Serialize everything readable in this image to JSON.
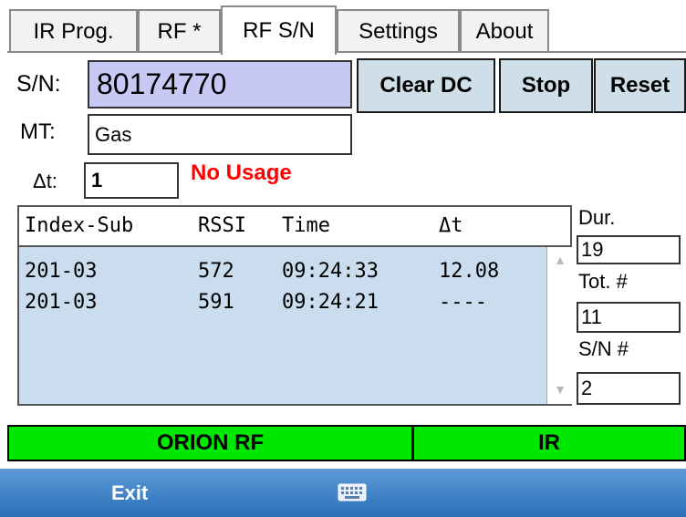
{
  "tabs": [
    {
      "label": "IR Prog.",
      "active": false
    },
    {
      "label": "RF *",
      "active": false
    },
    {
      "label": "RF S/N",
      "active": true
    },
    {
      "label": "Settings",
      "active": false
    },
    {
      "label": "About",
      "active": false
    }
  ],
  "sn": {
    "label": "S/N:",
    "value": "80174770"
  },
  "buttons": {
    "clear_dc": "Clear DC",
    "stop": "Stop",
    "reset": "Reset"
  },
  "mt": {
    "label": "MT:",
    "value": "Gas"
  },
  "dt": {
    "label": "Δt:",
    "value": "1",
    "status": "No Usage",
    "status_color": "#ff0000"
  },
  "list": {
    "headers": [
      "Index-Sub",
      "RSSI",
      "Time",
      "Δt"
    ],
    "rows": [
      {
        "index_sub": "201-03",
        "rssi": "572",
        "time": "09:24:33",
        "dt": "12.08"
      },
      {
        "index_sub": "201-03",
        "rssi": "591",
        "time": "09:24:21",
        "dt": "----"
      }
    ]
  },
  "side": {
    "dur_label": "Dur.",
    "dur_value": "19",
    "tot_label": "Tot. #",
    "tot_value": "11",
    "sn_label": "S/N #",
    "sn_value": "2"
  },
  "status_bar": {
    "left": "ORION RF",
    "right": "IR",
    "color": "#00e800"
  },
  "bottom": {
    "exit": "Exit",
    "keyboard_icon": "keyboard-icon"
  }
}
